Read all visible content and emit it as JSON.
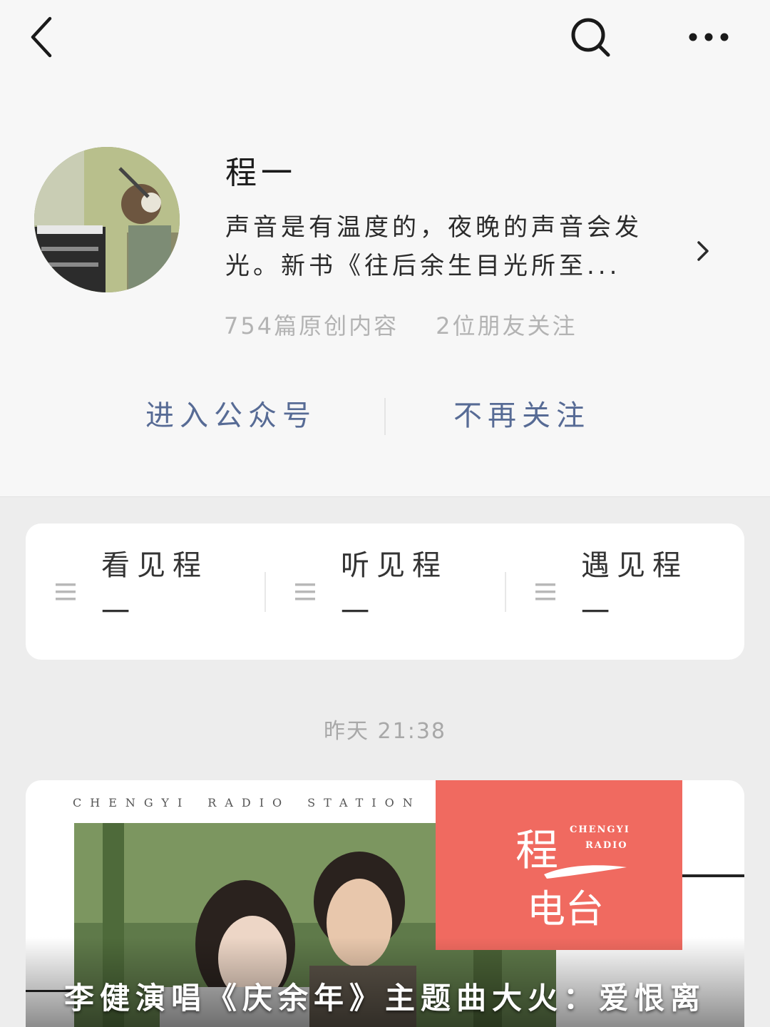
{
  "nav": {
    "back_icon": "back-arrow-icon",
    "search_icon": "search-icon",
    "more_icon": "more-dots-icon"
  },
  "profile": {
    "name": "程一",
    "description": "声音是有温度的，夜晚的声音会发光。新书《往后余生目光所至...",
    "stats": {
      "articles": "754篇原创内容",
      "friends": "2位朋友关注"
    },
    "enter_button": "进入公众号",
    "unfollow_button": "不再关注"
  },
  "menu": [
    {
      "label": "看见程一",
      "icon": "menu-lines-icon"
    },
    {
      "label": "听见程一",
      "icon": "menu-lines-icon"
    },
    {
      "label": "遇见程一",
      "icon": "menu-lines-icon"
    }
  ],
  "timestamp": "昨天 21:38",
  "article": {
    "header_words": [
      "CHENGYI",
      "RADIO",
      "STATION"
    ],
    "logo": {
      "big_top": "程",
      "big_bottom": "电台",
      "small_1": "CHENGYI",
      "small_2": "RADIO"
    },
    "title": "李健演唱《庆余年》主题曲大火：爱恨离"
  },
  "colors": {
    "link": "#576b95",
    "logo_bg": "#f06a60"
  }
}
